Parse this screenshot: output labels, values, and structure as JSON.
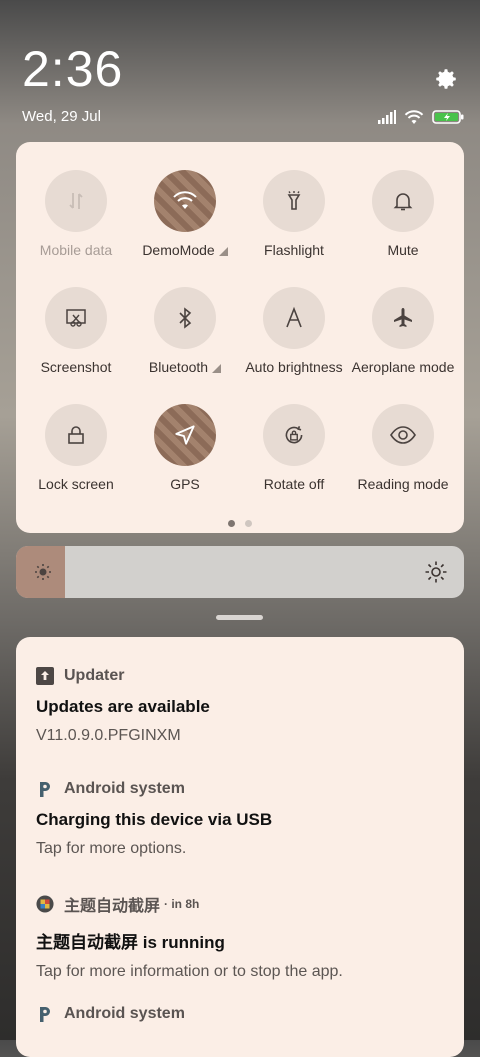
{
  "status": {
    "time": "2:36",
    "date": "Wed, 29 Jul",
    "icons": [
      "signal-icon",
      "wifi-icon",
      "battery-charging-icon"
    ]
  },
  "quick_settings": {
    "tiles": [
      {
        "label": "Mobile data",
        "icon": "mobile-data-icon",
        "state": "unavailable"
      },
      {
        "label": "DemoMode",
        "icon": "wifi-icon",
        "state": "on",
        "has_menu": true
      },
      {
        "label": "Flashlight",
        "icon": "flashlight-icon",
        "state": "off"
      },
      {
        "label": "Mute",
        "icon": "bell-icon",
        "state": "off"
      },
      {
        "label": "Screenshot",
        "icon": "screenshot-icon",
        "state": "off"
      },
      {
        "label": "Bluetooth",
        "icon": "bluetooth-icon",
        "state": "off",
        "has_menu": true
      },
      {
        "label": "Auto brightness",
        "icon": "auto-brightness-icon",
        "state": "off"
      },
      {
        "label": "Aeroplane mode",
        "icon": "aeroplane-icon",
        "state": "off"
      },
      {
        "label": "Lock screen",
        "icon": "lock-icon",
        "state": "off"
      },
      {
        "label": "GPS",
        "icon": "gps-icon",
        "state": "on"
      },
      {
        "label": "Rotate off",
        "icon": "rotate-lock-icon",
        "state": "off"
      },
      {
        "label": "Reading mode",
        "icon": "eye-icon",
        "state": "off"
      }
    ],
    "page_current": 1,
    "page_count": 2
  },
  "brightness": {
    "level": 0.11
  },
  "notifications": [
    {
      "app": "Updater",
      "time": "",
      "title": "Updates are available",
      "body": "V11.0.9.0.PFGINXM"
    },
    {
      "app": "Android system",
      "time": "",
      "title": "Charging this device via USB",
      "body": "Tap for more options."
    },
    {
      "app": "主题自动截屏",
      "time": "· in 8h",
      "title": "主题自动截屏 is running",
      "body": "Tap for more information or to stop the app."
    },
    {
      "app": "Android system",
      "time": "",
      "title": "",
      "body": ""
    }
  ],
  "colors": {
    "panel": "#fbeee6",
    "tile_off": "#e7dbd3",
    "brightness_fill": "#ad8b7b"
  }
}
